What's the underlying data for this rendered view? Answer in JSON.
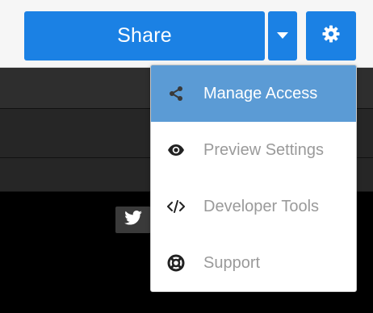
{
  "toolbar": {
    "share_label": "Share",
    "share_caret_icon": "caret-down-icon",
    "settings_icon": "gear-icon"
  },
  "content": {
    "twitter_icon": "twitter-icon"
  },
  "dropdown": {
    "items": [
      {
        "label": "Manage Access",
        "icon": "share-nodes-icon",
        "active": true
      },
      {
        "label": "Preview Settings",
        "icon": "eye-icon",
        "active": false
      },
      {
        "label": "Developer Tools",
        "icon": "code-icon",
        "active": false
      },
      {
        "label": "Support",
        "icon": "life-ring-icon",
        "active": false
      }
    ]
  },
  "colors": {
    "accent": "#1b81e4",
    "menu_active_bg": "#5b9bd5",
    "menu_text": "#9a9a9a",
    "content_bg": "#000000"
  }
}
